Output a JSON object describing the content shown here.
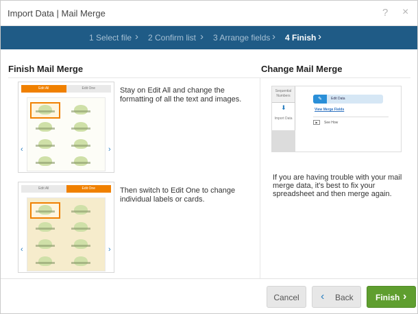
{
  "dialog": {
    "title": "Import Data | Mail Merge",
    "help_label": "?",
    "close_label": "×"
  },
  "steps": [
    {
      "label": "1 Select file",
      "active": false
    },
    {
      "label": "2 Confirm list",
      "active": false
    },
    {
      "label": "3 Arrange fields",
      "active": false
    },
    {
      "label": "4 Finish",
      "active": true
    }
  ],
  "finish_section": {
    "heading": "Finish Mail Merge",
    "edit_all_preview": {
      "tab_left": "Edit All",
      "tab_right": "Edit One",
      "active_tab": "Edit All"
    },
    "edit_all_text": "Stay on Edit All and change the formatting of all the text and images.",
    "edit_one_preview": {
      "tab_left": "Edit All",
      "tab_right": "Edit One",
      "active_tab": "Edit One"
    },
    "edit_one_text": "Then switch to Edit One to change individual labels or cards."
  },
  "change_section": {
    "heading": "Change Mail Merge",
    "preview": {
      "side_top": "Sequential Numbers",
      "side_import": "Import Data",
      "edit_data_label": "Edit Data",
      "view_fields_link": "View Merge Fields",
      "see_how_label": "See How"
    },
    "help_text": "If you are having trouble with your mail merge data, it's best to fix your spreadsheet and then merge again."
  },
  "footer": {
    "cancel_label": "Cancel",
    "back_label": "Back",
    "finish_label": "Finish"
  },
  "colors": {
    "steps_bar": "#1f5b86",
    "accent_orange": "#f08000",
    "finish_green": "#5f9e2f",
    "link_blue": "#2a7fc0"
  },
  "icons": [
    "help-icon",
    "close-icon",
    "chevron-right-icon",
    "chevron-left-icon",
    "edit-icon",
    "import-icon",
    "play-icon"
  ]
}
